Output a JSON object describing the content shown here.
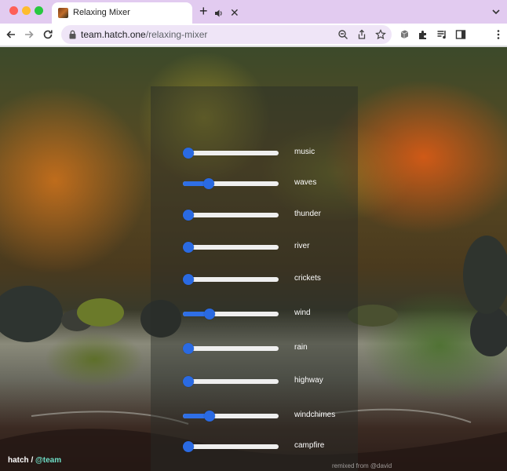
{
  "browser": {
    "tab": {
      "title": "Relaxing Mixer"
    },
    "url": {
      "host": "team.hatch.one",
      "path": "/relaxing-mixer"
    }
  },
  "mixer": {
    "tracks": [
      {
        "label": "music",
        "volume": 0.06
      },
      {
        "label": "waves",
        "volume": 0.27
      },
      {
        "label": "thunder",
        "volume": 0.06
      },
      {
        "label": "river",
        "volume": 0.06
      },
      {
        "label": "crickets",
        "volume": 0.06
      },
      {
        "label": "wind",
        "volume": 0.28
      },
      {
        "label": "rain",
        "volume": 0.06
      },
      {
        "label": "highway",
        "volume": 0.06
      },
      {
        "label": "windchimes",
        "volume": 0.28
      },
      {
        "label": "campfire",
        "volume": 0.06
      }
    ]
  },
  "footer": {
    "brand": "hatch",
    "separator": " / ",
    "team": "@team",
    "credit": "remixed from @david"
  },
  "colors": {
    "accent": "#2a6ae2",
    "tab_strip": "#e2cbf0",
    "team_link": "#6fe0c8"
  }
}
